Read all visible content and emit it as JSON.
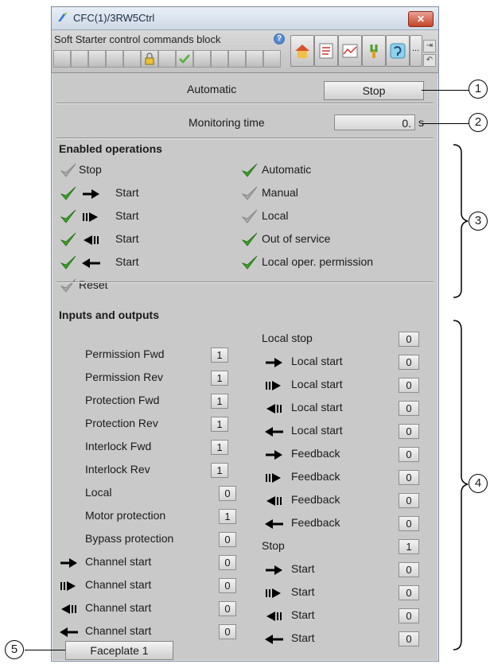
{
  "window": {
    "title": "CFC(1)/3RW5Ctrl",
    "close_label": "✕"
  },
  "toolbar": {
    "title": "Soft Starter control commands block",
    "help_label": "?",
    "more_label": "..."
  },
  "mode": {
    "label": "Automatic",
    "stop_button": "Stop"
  },
  "monitoring": {
    "label": "Monitoring time",
    "value": "0.",
    "unit": "s"
  },
  "enabled": {
    "title": "Enabled operations",
    "left": [
      {
        "label": "Stop",
        "enabled": false,
        "arrow": ""
      },
      {
        "label": "Start",
        "enabled": true,
        "arrow": "arrow-right"
      },
      {
        "label": "Start",
        "enabled": true,
        "arrow": "arrow-right-fast"
      },
      {
        "label": "Start",
        "enabled": true,
        "arrow": "arrow-left-fast"
      },
      {
        "label": "Start",
        "enabled": true,
        "arrow": "arrow-left"
      },
      {
        "label": "Reset",
        "enabled": false,
        "arrow": ""
      }
    ],
    "right": [
      {
        "label": "Automatic",
        "enabled": true
      },
      {
        "label": "Manual",
        "enabled": false
      },
      {
        "label": "Local",
        "enabled": false
      },
      {
        "label": "Out of service",
        "enabled": true
      },
      {
        "label": "Local oper. permission",
        "enabled": true
      }
    ]
  },
  "io": {
    "title": "Inputs and outputs",
    "left": [
      {
        "label": "Permission Fwd",
        "value": "1"
      },
      {
        "label": "Permission Rev",
        "value": "1"
      },
      {
        "label": "Protection Fwd",
        "value": "1"
      },
      {
        "label": "Protection Rev",
        "value": "1"
      },
      {
        "label": "Interlock Fwd",
        "value": "1"
      },
      {
        "label": "Interlock Rev",
        "value": "1"
      },
      {
        "label": "Local",
        "value": "0"
      },
      {
        "label": "Motor protection",
        "value": "1"
      },
      {
        "label": "Bypass protection",
        "value": "0"
      },
      {
        "label": "Channel start",
        "value": "0",
        "arrow": "arrow-right"
      },
      {
        "label": "Channel start",
        "value": "0",
        "arrow": "arrow-right-fast"
      },
      {
        "label": "Channel start",
        "value": "0",
        "arrow": "arrow-left-fast"
      },
      {
        "label": "Channel start",
        "value": "0",
        "arrow": "arrow-left"
      }
    ],
    "right": [
      {
        "label": "Local stop",
        "value": "0"
      },
      {
        "label": "Local start",
        "value": "0",
        "arrow": "arrow-right"
      },
      {
        "label": "Local start",
        "value": "0",
        "arrow": "arrow-right-fast"
      },
      {
        "label": "Local start",
        "value": "0",
        "arrow": "arrow-left-fast"
      },
      {
        "label": "Local start",
        "value": "0",
        "arrow": "arrow-left"
      },
      {
        "label": "Feedback",
        "value": "0",
        "arrow": "arrow-right"
      },
      {
        "label": "Feedback",
        "value": "0",
        "arrow": "arrow-right-fast"
      },
      {
        "label": "Feedback",
        "value": "0",
        "arrow": "arrow-left-fast"
      },
      {
        "label": "Feedback",
        "value": "0",
        "arrow": "arrow-left"
      },
      {
        "label": "Stop",
        "value": "1"
      },
      {
        "label": "Start",
        "value": "0",
        "arrow": "arrow-right"
      },
      {
        "label": "Start",
        "value": "0",
        "arrow": "arrow-right-fast"
      },
      {
        "label": "Start",
        "value": "0",
        "arrow": "arrow-left-fast"
      },
      {
        "label": "Start",
        "value": "0",
        "arrow": "arrow-left"
      }
    ]
  },
  "faceplate_button": "Faceplate 1",
  "callouts": [
    "1",
    "2",
    "3",
    "4",
    "5"
  ],
  "colors": {
    "check_enabled": "#3aa324",
    "check_disabled": "#a9a9a9",
    "panel_bg": "#c9c9c9"
  }
}
